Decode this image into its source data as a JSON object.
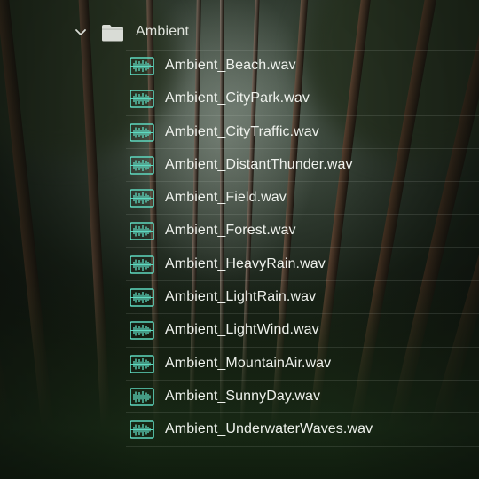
{
  "folder": {
    "name": "Ambient",
    "expanded": true,
    "chevron_icon": "chevron-down-icon",
    "folder_icon": "folder-icon"
  },
  "files": [
    {
      "name": "Ambient_Beach.wav",
      "icon": "waveform-icon"
    },
    {
      "name": "Ambient_CityPark.wav",
      "icon": "waveform-icon"
    },
    {
      "name": "Ambient_CityTraffic.wav",
      "icon": "waveform-icon"
    },
    {
      "name": "Ambient_DistantThunder.wav",
      "icon": "waveform-icon"
    },
    {
      "name": "Ambient_Field.wav",
      "icon": "waveform-icon"
    },
    {
      "name": "Ambient_Forest.wav",
      "icon": "waveform-icon"
    },
    {
      "name": "Ambient_HeavyRain.wav",
      "icon": "waveform-icon"
    },
    {
      "name": "Ambient_LightRain.wav",
      "icon": "waveform-icon"
    },
    {
      "name": "Ambient_LightWind.wav",
      "icon": "waveform-icon"
    },
    {
      "name": "Ambient_MountainAir.wav",
      "icon": "waveform-icon"
    },
    {
      "name": "Ambient_SunnyDay.wav",
      "icon": "waveform-icon"
    },
    {
      "name": "Ambient_UnderwaterWaves.wav",
      "icon": "waveform-icon"
    }
  ],
  "colors": {
    "icon_accent": "#5fd9c0",
    "text": "#eef1ec",
    "folder": "#d9dcd6"
  }
}
